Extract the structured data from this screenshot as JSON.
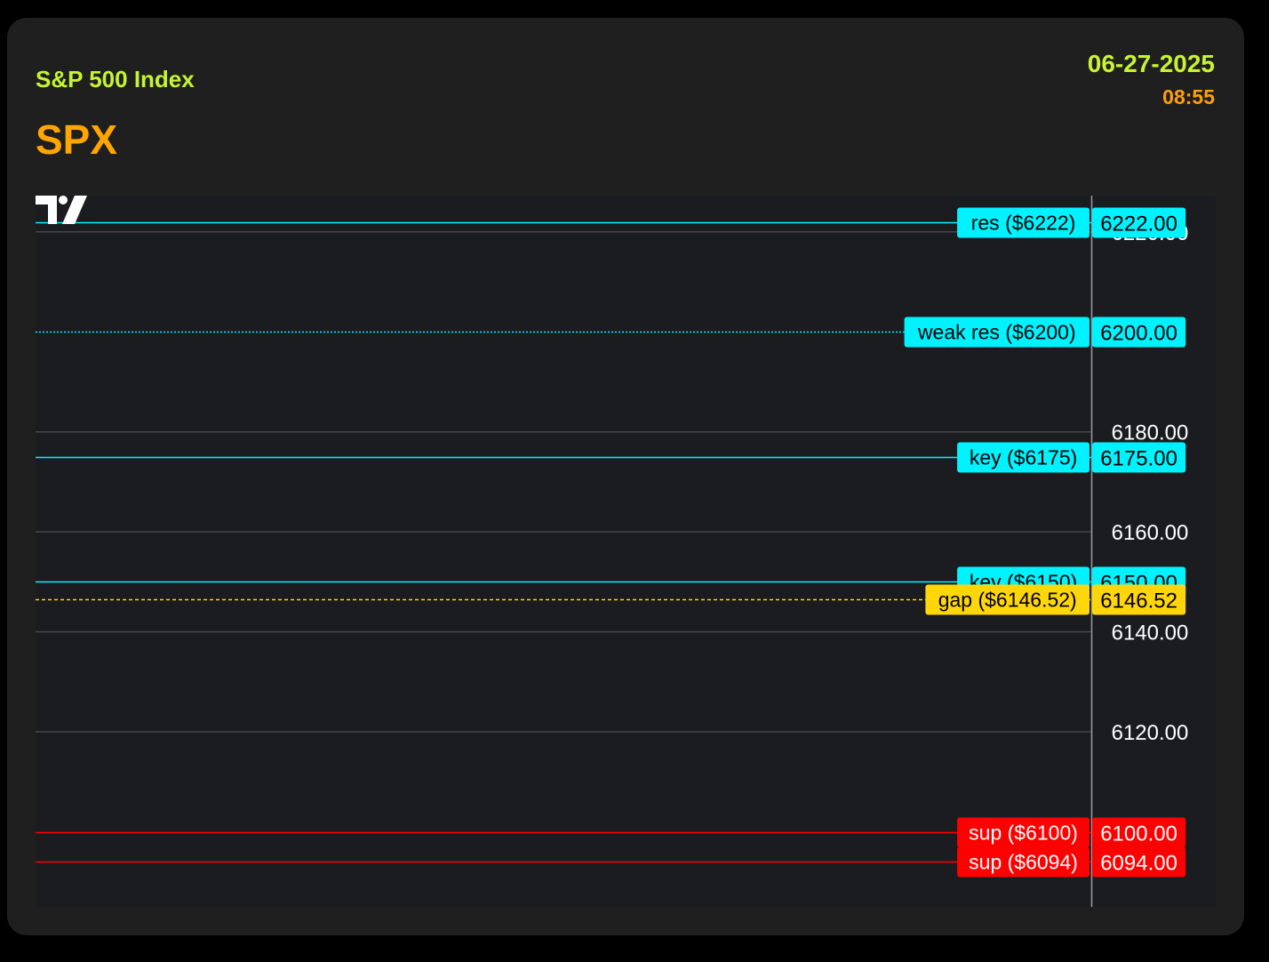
{
  "header": {
    "index_name": "S&P 500 Index",
    "ticker": "SPX",
    "date": "06-27-2025",
    "time": "08:55"
  },
  "colors": {
    "card_bg": "#1f1f1f",
    "chart_bg": "#1b1c20",
    "subtitle": "#c6f432",
    "ticker": "#ffa500",
    "time": "#ff9f0a",
    "grid": "#45464b",
    "axis_text": "#ffffff",
    "cyan": "#00f2ff",
    "yellow": "#ffd60a",
    "red": "#ff0000"
  },
  "chart_data": {
    "type": "line",
    "ylim": [
      6085,
      6227.25
    ],
    "grid": true,
    "y_ticks": [
      "6120.00",
      "6140.00",
      "6160.00",
      "6180.00",
      "6220.00"
    ],
    "y_tick_values": [
      6120,
      6140,
      6160,
      6180,
      6220
    ],
    "levels": [
      {
        "label": "res ($6222)",
        "value": 6222,
        "axis_label": "6222.00",
        "color": "#00f2ff",
        "style": "solid"
      },
      {
        "label": "weak res ($6200)",
        "value": 6200,
        "axis_label": "6200.00",
        "color": "#00f2ff",
        "style": "dotted"
      },
      {
        "label": "key ($6175)",
        "value": 6175,
        "axis_label": "6175.00",
        "color": "#00f2ff",
        "style": "solid"
      },
      {
        "label": "key ($6150)",
        "value": 6150,
        "axis_label": "6150.00",
        "color": "#00f2ff",
        "style": "solid"
      },
      {
        "label": "gap ($6146.52)",
        "value": 6146.52,
        "axis_label": "6146.52",
        "color": "#ffd60a",
        "style": "dashed"
      },
      {
        "label": "sup ($6100)",
        "value": 6100,
        "axis_label": "6100.00",
        "color": "#ff0000",
        "style": "solid"
      },
      {
        "label": "sup ($6094)",
        "value": 6094,
        "axis_label": "6094.00",
        "color": "#ff0000",
        "style": "solid"
      }
    ]
  }
}
